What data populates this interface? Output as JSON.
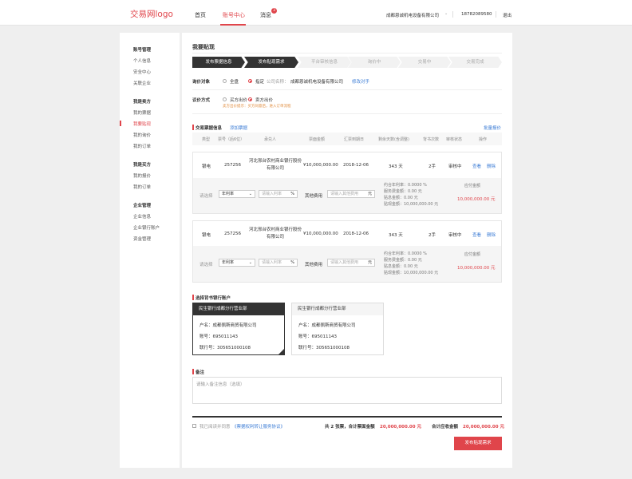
{
  "header": {
    "logo": "交易网logo",
    "nav": [
      "首页",
      "账号中心",
      "消息"
    ],
    "badge": "3",
    "company": "成都恩诚机电设备有限公司",
    "phone": "18782089580",
    "logout": "退出"
  },
  "sidebar": {
    "groups": [
      {
        "title": "账号管理",
        "items": [
          "个人信息",
          "安全中心",
          "关联企业"
        ]
      },
      {
        "title": "我是卖方",
        "items": [
          "我的票据",
          "我要贴现",
          "我的询价",
          "我的订单"
        ]
      },
      {
        "title": "我是买方",
        "items": [
          "我的报价",
          "我的订单"
        ]
      },
      {
        "title": "企业管理",
        "items": [
          "企业信息",
          "企业银行账户",
          "资金管理"
        ]
      }
    ]
  },
  "page": {
    "title": "我要贴现",
    "steps": [
      "发布票据信息",
      "发布贴现需求",
      "平台审核信息",
      "询价中",
      "交易中",
      "交易完成"
    ]
  },
  "form": {
    "target_label": "询价对象",
    "target_all": "全盘",
    "target_specific": "指定",
    "company_label": "公司名称：",
    "company_value": "成都恩诚机电设备有限公司",
    "modify": "修改对手",
    "method_label": "议价方式",
    "method_buyer": "买方出价",
    "method_seller": "卖方出价",
    "method_note": "卖方出价提示：买方同意后，进入订单流程"
  },
  "bills": {
    "title": "交易票据信息",
    "add": "添加票据",
    "batch": "批量报价",
    "headers": [
      "类型",
      "票号（后6位）",
      "承兑人",
      "票面金额",
      "汇票到期日",
      "剩余天数(含调整)",
      "背书次数",
      "审核状态",
      "操作"
    ],
    "rows": [
      {
        "type": "银电",
        "no": "257256",
        "acceptor": "河北邢台农村商业银行股份有限公司",
        "amount": "¥10,000,000.00",
        "due": "2018-12-06",
        "days": "343 天",
        "endorse": "2手",
        "status": "审核中",
        "view": "查看",
        "del": "删除",
        "select": "请选择",
        "rate_type": "年利率",
        "rate_ph": "请输入利率",
        "pct": "%",
        "fee_label": "其他费用",
        "fee_ph": "请输入其他费用",
        "yuan": "元",
        "lines": [
          "约合年利率：0.0000 %",
          "服务费金额：0.00 元",
          "贴息金额：0.00 元",
          "贴现金额：10,000,000.00 元"
        ],
        "settle_label": "应付金额",
        "settle_value": "10,000,000.00 元"
      },
      {
        "type": "银电",
        "no": "257256",
        "acceptor": "河北邢台农村商业银行股份有限公司",
        "amount": "¥10,000,000.00",
        "due": "2018-12-06",
        "days": "343 天",
        "endorse": "2手",
        "status": "审核中",
        "view": "查看",
        "del": "删除",
        "select": "请选择",
        "rate_type": "年利率",
        "rate_ph": "请输入利率",
        "pct": "%",
        "fee_label": "其他费用",
        "fee_ph": "请输入其他费用",
        "yuan": "元",
        "lines": [
          "约合年利率：0.0000 %",
          "服务费金额：0.00 元",
          "贴息金额：0.00 元",
          "贴现金额：10,000,000.00 元"
        ],
        "settle_label": "应付金额",
        "settle_value": "10,000,000.00 元"
      }
    ]
  },
  "bank": {
    "title": "选择背书银行账户",
    "cards": [
      {
        "name": "民生银行成都分行营业部",
        "owner": "户名：成都佩斯商贸有限公司",
        "account": "账号：695011143",
        "line": "联行号：305651000108"
      },
      {
        "name": "民生银行成都分行营业部",
        "owner": "户名：成都佩斯商贸有限公司",
        "account": "账号：695011143",
        "line": "联行号：305651000108"
      }
    ]
  },
  "remark": {
    "title": "备注",
    "placeholder": "请输入备注信息（选填）"
  },
  "footer": {
    "agree": "我已阅读并同意",
    "protocol": "《票据权利转让服务协议》",
    "total_prefix": "共 2 张票，合计票面金额",
    "total_value": "20,000,000.00 元",
    "settle_prefix": "合计应收金额",
    "settle_value": "20,000,000.00 元",
    "submit": "发布贴现需求"
  }
}
